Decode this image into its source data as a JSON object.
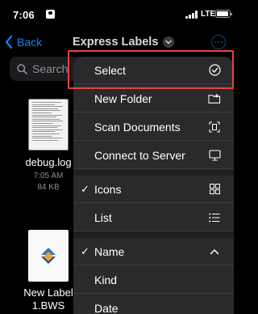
{
  "status_bar": {
    "time": "7:06",
    "network": "LTE"
  },
  "nav": {
    "back_label": "Back",
    "title": "Express Labels"
  },
  "search": {
    "placeholder": "Search"
  },
  "files": [
    {
      "name": "debug.log",
      "time": "7:05 AM",
      "size": "84 KB"
    },
    {
      "name_line1": "New Label",
      "name_line2": "1.BWS"
    }
  ],
  "menu": {
    "select": "Select",
    "new_folder": "New Folder",
    "scan_documents": "Scan Documents",
    "connect_to_server": "Connect to Server",
    "icons": "Icons",
    "list": "List",
    "name": "Name",
    "kind": "Kind",
    "date": "Date"
  },
  "colors": {
    "accent": "#0a84ff",
    "highlight": "#e8433b",
    "menu_bg": "#2a2a2c"
  }
}
